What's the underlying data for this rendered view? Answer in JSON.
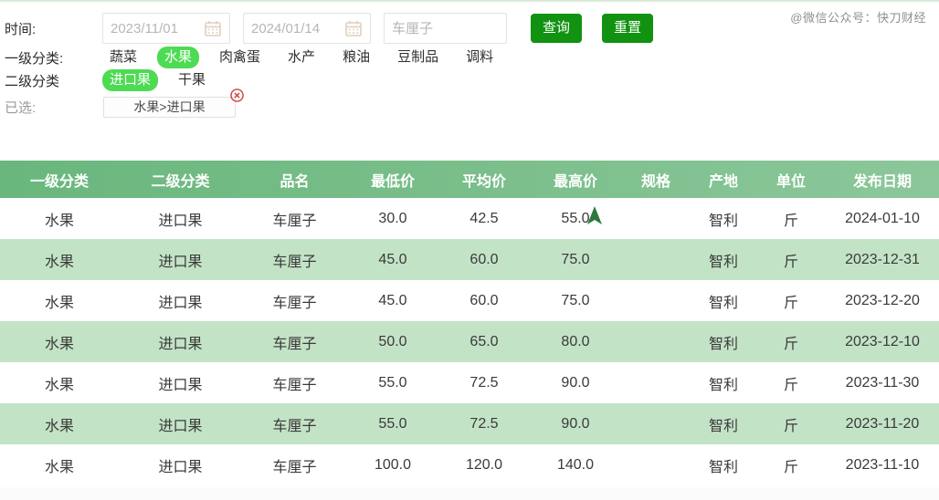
{
  "watermark": {
    "text": "@微信公众号：快刀财经"
  },
  "filters": {
    "time_label": "时间:",
    "date_from": "2023/11/01",
    "date_to": "2024/01/14",
    "date_from_placeholder": "2023/11/01",
    "date_to_placeholder": "2024/01/14",
    "keyword": "车厘子",
    "keyword_placeholder": "车厘子",
    "query_button": "查询",
    "reset_button": "重置",
    "cat1_label": "一级分类:",
    "cat1_items": [
      "蔬菜",
      "水果",
      "肉禽蛋",
      "水产",
      "粮油",
      "豆制品",
      "调料"
    ],
    "cat1_active": "水果",
    "cat2_label": "二级分类",
    "cat2_items": [
      "进口果",
      "干果"
    ],
    "cat2_active": "进口果",
    "selected_label": "已选:",
    "selected_token": "水果>进口果"
  },
  "table": {
    "columns": [
      "一级分类",
      "二级分类",
      "品名",
      "最低价",
      "平均价",
      "最高价",
      "规格",
      "产地",
      "单位",
      "发布日期"
    ],
    "rows": [
      [
        "水果",
        "进口果",
        "车厘子",
        "30.0",
        "42.5",
        "55.0",
        "",
        "智利",
        "斤",
        "2024-01-10"
      ],
      [
        "水果",
        "进口果",
        "车厘子",
        "45.0",
        "60.0",
        "75.0",
        "",
        "智利",
        "斤",
        "2023-12-31"
      ],
      [
        "水果",
        "进口果",
        "车厘子",
        "45.0",
        "60.0",
        "75.0",
        "",
        "智利",
        "斤",
        "2023-12-20"
      ],
      [
        "水果",
        "进口果",
        "车厘子",
        "50.0",
        "65.0",
        "80.0",
        "",
        "智利",
        "斤",
        "2023-12-10"
      ],
      [
        "水果",
        "进口果",
        "车厘子",
        "55.0",
        "72.5",
        "90.0",
        "",
        "智利",
        "斤",
        "2023-11-30"
      ],
      [
        "水果",
        "进口果",
        "车厘子",
        "55.0",
        "72.5",
        "90.0",
        "",
        "智利",
        "斤",
        "2023-11-20"
      ],
      [
        "水果",
        "进口果",
        "车厘子",
        "100.0",
        "120.0",
        "140.0",
        "",
        "智利",
        "斤",
        "2023-11-10"
      ]
    ]
  },
  "annotation": {
    "arrow_direction": "up",
    "arrow_color": "#2c7a3d"
  },
  "colors": {
    "header_green": "#6fb983",
    "row_alt_green": "#c3e3c6",
    "button_green": "#119211",
    "chip_green": "#4ddb53",
    "arrow_green": "#2c7a3d"
  }
}
